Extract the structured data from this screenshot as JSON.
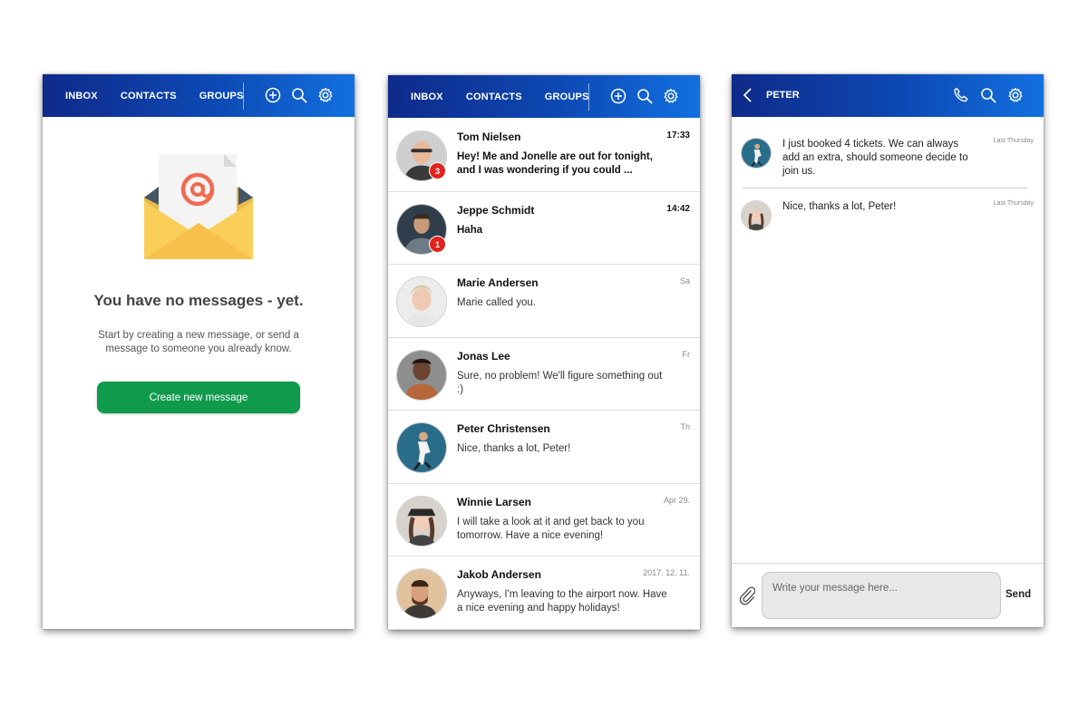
{
  "colors": {
    "appbar_start": "#0f2a8a",
    "appbar_end": "#1270e0",
    "primary_button": "#0f9a4c",
    "unread_badge": "#e0231f"
  },
  "inbox_empty": {
    "nav": [
      "INBOX",
      "CONTACTS",
      "GROUPS"
    ],
    "icons": [
      "add-icon",
      "search-icon",
      "settings-icon"
    ],
    "illustration": "envelope-at-icon",
    "title": "You have no messages - yet.",
    "text": "Start by creating a new message, or send a message to someone you already know.",
    "button": "Create new message"
  },
  "inbox_list": {
    "nav": [
      "INBOX",
      "CONTACTS",
      "GROUPS"
    ],
    "icons": [
      "add-icon",
      "search-icon",
      "settings-icon"
    ],
    "conversations": [
      {
        "name": "Tom Nielsen",
        "time": "17:33",
        "preview": "Hey! Me and Jonelle are out for tonight, and I was wondering if you could ...",
        "unread": "3"
      },
      {
        "name": "Jeppe Schmidt",
        "time": "14:42",
        "preview": "Haha",
        "unread": "1"
      },
      {
        "name": "Marie Andersen",
        "time": "Sa",
        "preview": "Marie called you."
      },
      {
        "name": "Jonas Lee",
        "time": "Fr",
        "preview": "Sure, no problem! We'll figure something out :)"
      },
      {
        "name": "Peter Christensen",
        "time": "Th",
        "preview": "Nice, thanks a lot, Peter!"
      },
      {
        "name": "Winnie Larsen",
        "time": "Apr 29.",
        "preview": "I will take a look at it and get back to you tomorrow. Have a nice evening!"
      },
      {
        "name": "Jakob Andersen",
        "time": "2017. 12. 11.",
        "preview": "Anyways, I'm leaving to the airport now. Have a nice evening and happy holidays!"
      }
    ]
  },
  "chat": {
    "title": "PETER",
    "icons": [
      "back-icon",
      "phone-icon",
      "search-icon",
      "settings-icon"
    ],
    "messages": [
      {
        "text": "I just booked 4 tickets.  We can always add an extra, should someone decide to join us.",
        "time": "Last Thursday"
      },
      {
        "text": "Nice, thanks a lot, Peter!",
        "time": "Last Thursday"
      }
    ],
    "input_placeholder": "Write your message here...",
    "send": "Send",
    "attach_icon": "paperclip-icon"
  }
}
